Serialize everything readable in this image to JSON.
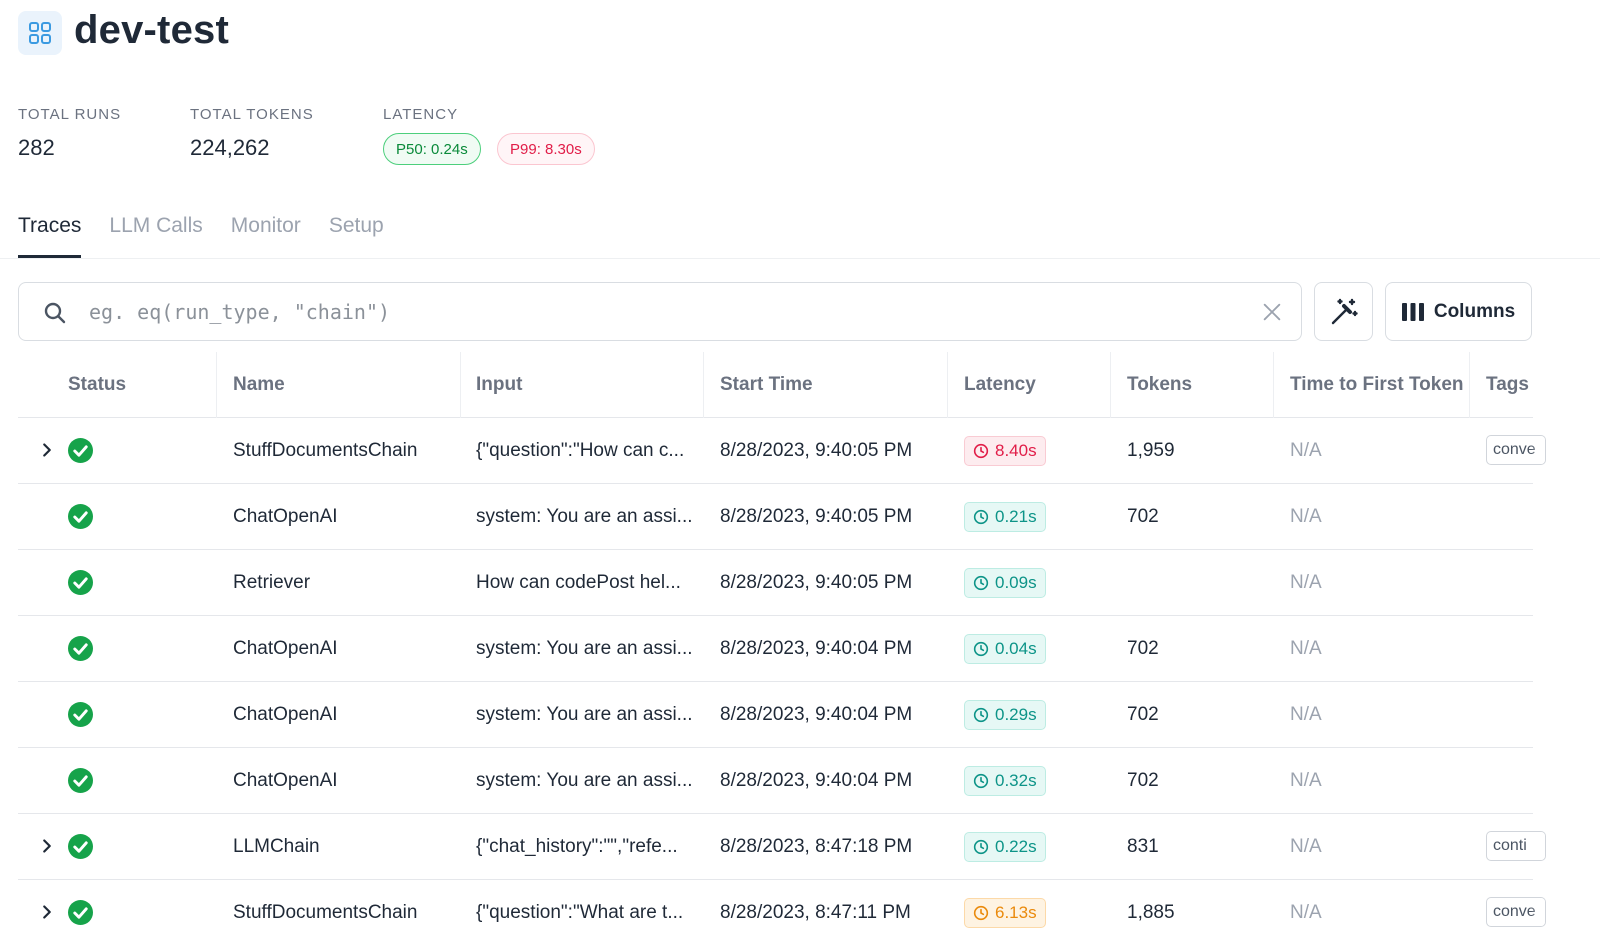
{
  "header": {
    "title": "dev-test",
    "icon": "grid-icon"
  },
  "stats": {
    "total_runs_label": "TOTAL RUNS",
    "total_runs_value": "282",
    "total_tokens_label": "TOTAL TOKENS",
    "total_tokens_value": "224,262",
    "latency_label": "LATENCY",
    "p50": "P50: 0.24s",
    "p99": "P99: 8.30s"
  },
  "tabs": [
    {
      "label": "Traces",
      "active": true
    },
    {
      "label": "LLM Calls",
      "active": false
    },
    {
      "label": "Monitor",
      "active": false
    },
    {
      "label": "Setup",
      "active": false
    }
  ],
  "search": {
    "placeholder": "eg. eq(run_type, \"chain\")",
    "value": ""
  },
  "toolbar": {
    "columns_label": "Columns"
  },
  "table": {
    "columns": [
      "Status",
      "Name",
      "Input",
      "Start Time",
      "Latency",
      "Tokens",
      "Time to First Token",
      "Tags"
    ],
    "rows": [
      {
        "expandable": true,
        "name": "StuffDocumentsChain",
        "input": "{\"question\":\"How can c...",
        "start_time": "8/28/2023, 9:40:05 PM",
        "latency": "8.40s",
        "latency_level": "red",
        "tokens": "1,959",
        "ttft": "N/A",
        "tag": "conve"
      },
      {
        "expandable": false,
        "name": "ChatOpenAI",
        "input": "system: You are an assi...",
        "start_time": "8/28/2023, 9:40:05 PM",
        "latency": "0.21s",
        "latency_level": "green",
        "tokens": "702",
        "ttft": "N/A",
        "tag": ""
      },
      {
        "expandable": false,
        "name": "Retriever",
        "input": "How can codePost hel...",
        "start_time": "8/28/2023, 9:40:05 PM",
        "latency": "0.09s",
        "latency_level": "green",
        "tokens": "",
        "ttft": "N/A",
        "tag": ""
      },
      {
        "expandable": false,
        "name": "ChatOpenAI",
        "input": "system: You are an assi...",
        "start_time": "8/28/2023, 9:40:04 PM",
        "latency": "0.04s",
        "latency_level": "green",
        "tokens": "702",
        "ttft": "N/A",
        "tag": ""
      },
      {
        "expandable": false,
        "name": "ChatOpenAI",
        "input": "system: You are an assi...",
        "start_time": "8/28/2023, 9:40:04 PM",
        "latency": "0.29s",
        "latency_level": "green",
        "tokens": "702",
        "ttft": "N/A",
        "tag": ""
      },
      {
        "expandable": false,
        "name": "ChatOpenAI",
        "input": "system: You are an assi...",
        "start_time": "8/28/2023, 9:40:04 PM",
        "latency": "0.32s",
        "latency_level": "green",
        "tokens": "702",
        "ttft": "N/A",
        "tag": ""
      },
      {
        "expandable": true,
        "name": "LLMChain",
        "input": "{\"chat_history\":\"\",\"refe...",
        "start_time": "8/28/2023, 8:47:18 PM",
        "latency": "0.22s",
        "latency_level": "green",
        "tokens": "831",
        "ttft": "N/A",
        "tag": "conti"
      },
      {
        "expandable": true,
        "name": "StuffDocumentsChain",
        "input": "{\"question\":\"What are t...",
        "start_time": "8/28/2023, 8:47:11 PM",
        "latency": "6.13s",
        "latency_level": "orange",
        "tokens": "1,885",
        "ttft": "N/A",
        "tag": "conve"
      }
    ]
  },
  "colors": {
    "latency_green": "#0d9488",
    "latency_red": "#e11d48",
    "latency_orange": "#ea8a0c",
    "status_success": "#16a34a"
  }
}
